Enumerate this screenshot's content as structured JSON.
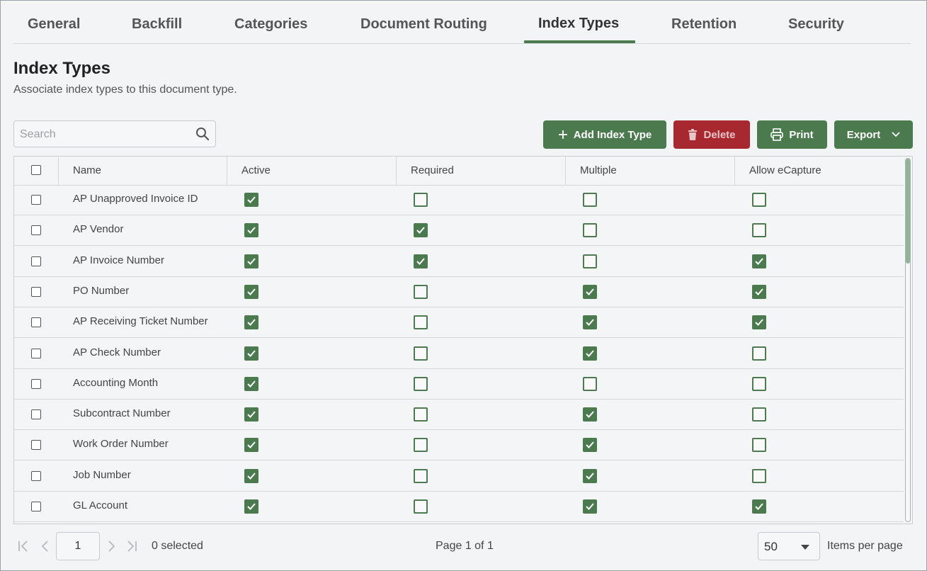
{
  "tabs": [
    {
      "label": "General"
    },
    {
      "label": "Backfill"
    },
    {
      "label": "Categories"
    },
    {
      "label": "Document Routing"
    },
    {
      "label": "Index Types"
    },
    {
      "label": "Retention"
    },
    {
      "label": "Security"
    }
  ],
  "active_tab": "Index Types",
  "page": {
    "title": "Index Types",
    "subtitle": "Associate index types to this document type."
  },
  "search": {
    "placeholder": "Search",
    "value": "",
    "icon": "search-icon"
  },
  "toolbar": {
    "add_label": "Add Index Type",
    "delete_label": "Delete",
    "print_label": "Print",
    "export_label": "Export"
  },
  "colors": {
    "accent_green": "#4a7a4e",
    "danger_red": "#a8282f"
  },
  "table": {
    "columns": [
      "Name",
      "Active",
      "Required",
      "Multiple",
      "Allow eCapture"
    ],
    "rows": [
      {
        "name": "AP Unapproved Invoice ID",
        "active": true,
        "required": false,
        "multiple": false,
        "ecapture": false
      },
      {
        "name": "AP Vendor",
        "active": true,
        "required": true,
        "multiple": false,
        "ecapture": false
      },
      {
        "name": "AP Invoice Number",
        "active": true,
        "required": true,
        "multiple": false,
        "ecapture": true
      },
      {
        "name": "PO Number",
        "active": true,
        "required": false,
        "multiple": true,
        "ecapture": true
      },
      {
        "name": "AP Receiving Ticket Number",
        "active": true,
        "required": false,
        "multiple": true,
        "ecapture": true
      },
      {
        "name": "AP Check Number",
        "active": true,
        "required": false,
        "multiple": true,
        "ecapture": false
      },
      {
        "name": "Accounting Month",
        "active": true,
        "required": false,
        "multiple": false,
        "ecapture": false
      },
      {
        "name": "Subcontract Number",
        "active": true,
        "required": false,
        "multiple": true,
        "ecapture": false
      },
      {
        "name": "Work Order Number",
        "active": true,
        "required": false,
        "multiple": true,
        "ecapture": false
      },
      {
        "name": "Job Number",
        "active": true,
        "required": false,
        "multiple": true,
        "ecapture": false
      },
      {
        "name": "GL Account",
        "active": true,
        "required": false,
        "multiple": true,
        "ecapture": true
      }
    ]
  },
  "footer": {
    "page_value": "1",
    "selected_text": "0 selected",
    "page_info": "Page 1 of 1",
    "per_page_value": "50",
    "per_page_label": "Items per page"
  }
}
